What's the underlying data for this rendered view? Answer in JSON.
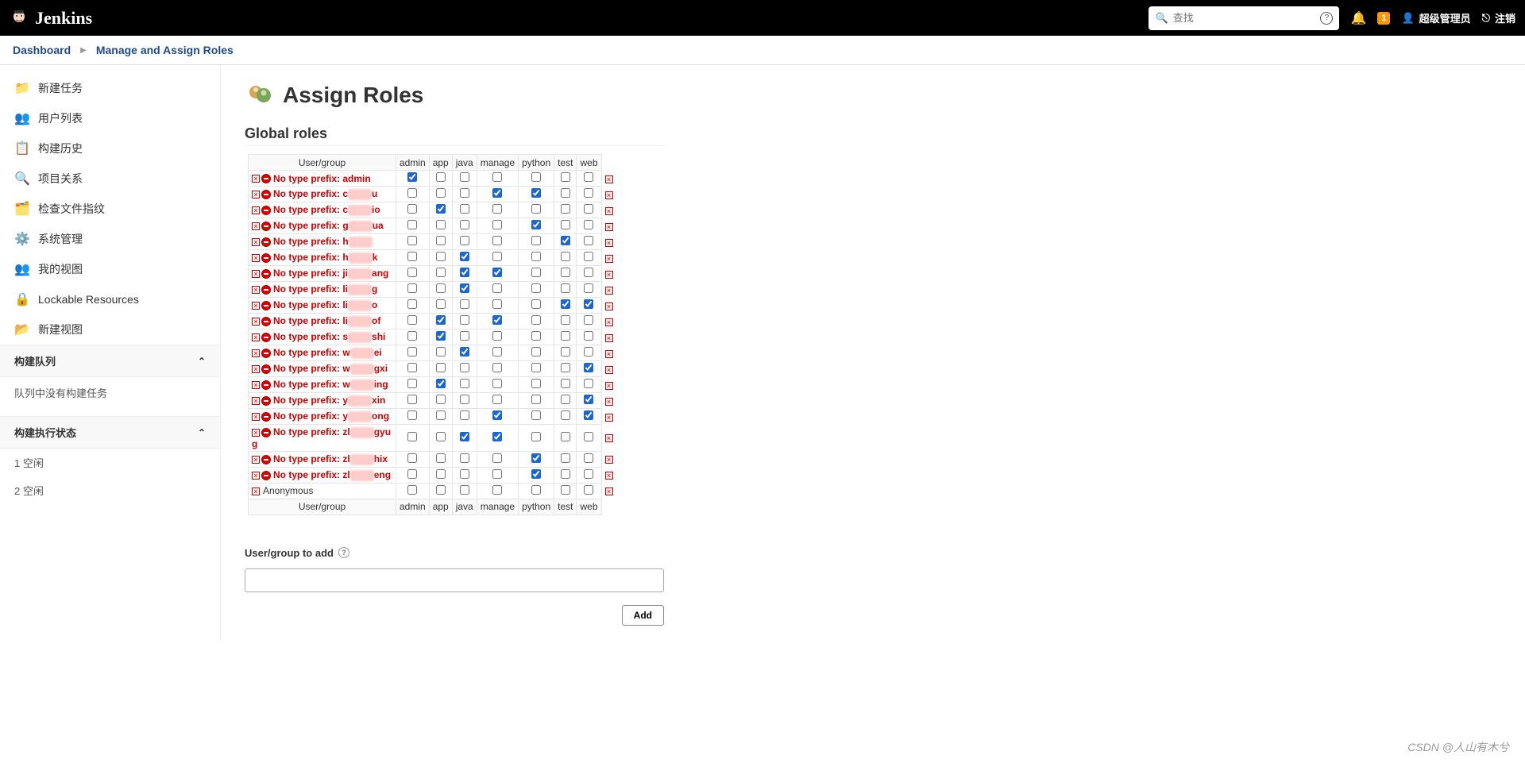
{
  "brand": "Jenkins",
  "search_placeholder": "查找",
  "notification_count": "1",
  "user_display": "超级管理员",
  "logout_label": "注销",
  "breadcrumbs": [
    {
      "label": "Dashboard"
    },
    {
      "label": "Manage and Assign Roles"
    }
  ],
  "sidebar_links": [
    {
      "label": "新建任务",
      "icon_color": "#e8a33d"
    },
    {
      "label": "用户列表",
      "icon_color": "#6aa8d8"
    },
    {
      "label": "构建历史",
      "icon_color": "#ccc"
    },
    {
      "label": "项目关系",
      "icon_color": "#888"
    },
    {
      "label": "检查文件指纹",
      "icon_color": "#557"
    },
    {
      "label": "系统管理",
      "icon_color": "#888"
    },
    {
      "label": "我的视图",
      "icon_color": "#6aa8d8"
    },
    {
      "label": "Lockable Resources",
      "icon_color": "#555"
    },
    {
      "label": "新建视图",
      "icon_color": "#6aa8d8"
    }
  ],
  "queue_header": "构建队列",
  "queue_empty": "队列中没有构建任务",
  "exec_header": "构建执行状态",
  "exec_1": "1 空闲",
  "exec_2": "2 空闲",
  "page_title": "Assign Roles",
  "section_global": "Global roles",
  "col_usergroup": "User/group",
  "columns": [
    "admin",
    "app",
    "java",
    "manage",
    "python",
    "test",
    "web"
  ],
  "rows": [
    {
      "prefix": "No type prefix:",
      "name": "admin",
      "blur": false,
      "checks": [
        true,
        false,
        false,
        false,
        false,
        false,
        false
      ]
    },
    {
      "prefix": "No type prefix:",
      "name": "c",
      "blur": true,
      "suffix": "u",
      "checks": [
        false,
        false,
        false,
        true,
        true,
        false,
        false
      ]
    },
    {
      "prefix": "No type prefix:",
      "name": "c",
      "blur": true,
      "suffix": "io",
      "checks": [
        false,
        true,
        false,
        false,
        false,
        false,
        false
      ]
    },
    {
      "prefix": "No type prefix:",
      "name": "g",
      "blur": true,
      "suffix": "ua",
      "checks": [
        false,
        false,
        false,
        false,
        true,
        false,
        false
      ]
    },
    {
      "prefix": "No type prefix:",
      "name": "h",
      "blur": true,
      "suffix": "",
      "checks": [
        false,
        false,
        false,
        false,
        false,
        true,
        false
      ]
    },
    {
      "prefix": "No type prefix:",
      "name": "h",
      "blur": true,
      "suffix": "k",
      "checks": [
        false,
        false,
        true,
        false,
        false,
        false,
        false
      ]
    },
    {
      "prefix": "No type prefix:",
      "name": "ji",
      "blur": true,
      "suffix": "ang",
      "checks": [
        false,
        false,
        true,
        true,
        false,
        false,
        false
      ]
    },
    {
      "prefix": "No type prefix:",
      "name": "li",
      "blur": true,
      "suffix": "g",
      "checks": [
        false,
        false,
        true,
        false,
        false,
        false,
        false
      ]
    },
    {
      "prefix": "No type prefix:",
      "name": "li",
      "blur": true,
      "suffix": "o",
      "checks": [
        false,
        false,
        false,
        false,
        false,
        true,
        true
      ]
    },
    {
      "prefix": "No type prefix:",
      "name": "li",
      "blur": true,
      "suffix": "of",
      "checks": [
        false,
        true,
        false,
        true,
        false,
        false,
        false
      ]
    },
    {
      "prefix": "No type prefix:",
      "name": "s",
      "blur": true,
      "suffix": "shi",
      "checks": [
        false,
        true,
        false,
        false,
        false,
        false,
        false
      ]
    },
    {
      "prefix": "No type prefix:",
      "name": "w",
      "blur": true,
      "suffix": "ei",
      "checks": [
        false,
        false,
        true,
        false,
        false,
        false,
        false
      ]
    },
    {
      "prefix": "No type prefix:",
      "name": "w",
      "blur": true,
      "suffix": "gxi",
      "checks": [
        false,
        false,
        false,
        false,
        false,
        false,
        true
      ]
    },
    {
      "prefix": "No type prefix:",
      "name": "w",
      "blur": true,
      "suffix": "ing",
      "checks": [
        false,
        true,
        false,
        false,
        false,
        false,
        false
      ]
    },
    {
      "prefix": "No type prefix:",
      "name": "y",
      "blur": true,
      "suffix": "xin",
      "checks": [
        false,
        false,
        false,
        false,
        false,
        false,
        true
      ]
    },
    {
      "prefix": "No type prefix:",
      "name": "y",
      "blur": true,
      "suffix": "ong",
      "checks": [
        false,
        false,
        false,
        true,
        false,
        false,
        true
      ]
    },
    {
      "prefix": "No type prefix:",
      "name": "zl",
      "blur": true,
      "suffix": "gyu  g",
      "checks": [
        false,
        false,
        true,
        true,
        false,
        false,
        false
      ]
    },
    {
      "prefix": "No type prefix:",
      "name": "zl",
      "blur": true,
      "suffix": "hix",
      "checks": [
        false,
        false,
        false,
        false,
        true,
        false,
        false
      ]
    },
    {
      "prefix": "No type prefix:",
      "name": "zl",
      "blur": true,
      "suffix": "eng",
      "checks": [
        false,
        false,
        false,
        false,
        true,
        false,
        false
      ]
    }
  ],
  "anonymous_label": "Anonymous",
  "anonymous_checks": [
    false,
    false,
    false,
    false,
    false,
    false,
    false
  ],
  "add_label": "User/group to add",
  "add_button": "Add",
  "watermark": "CSDN @人山有木兮"
}
